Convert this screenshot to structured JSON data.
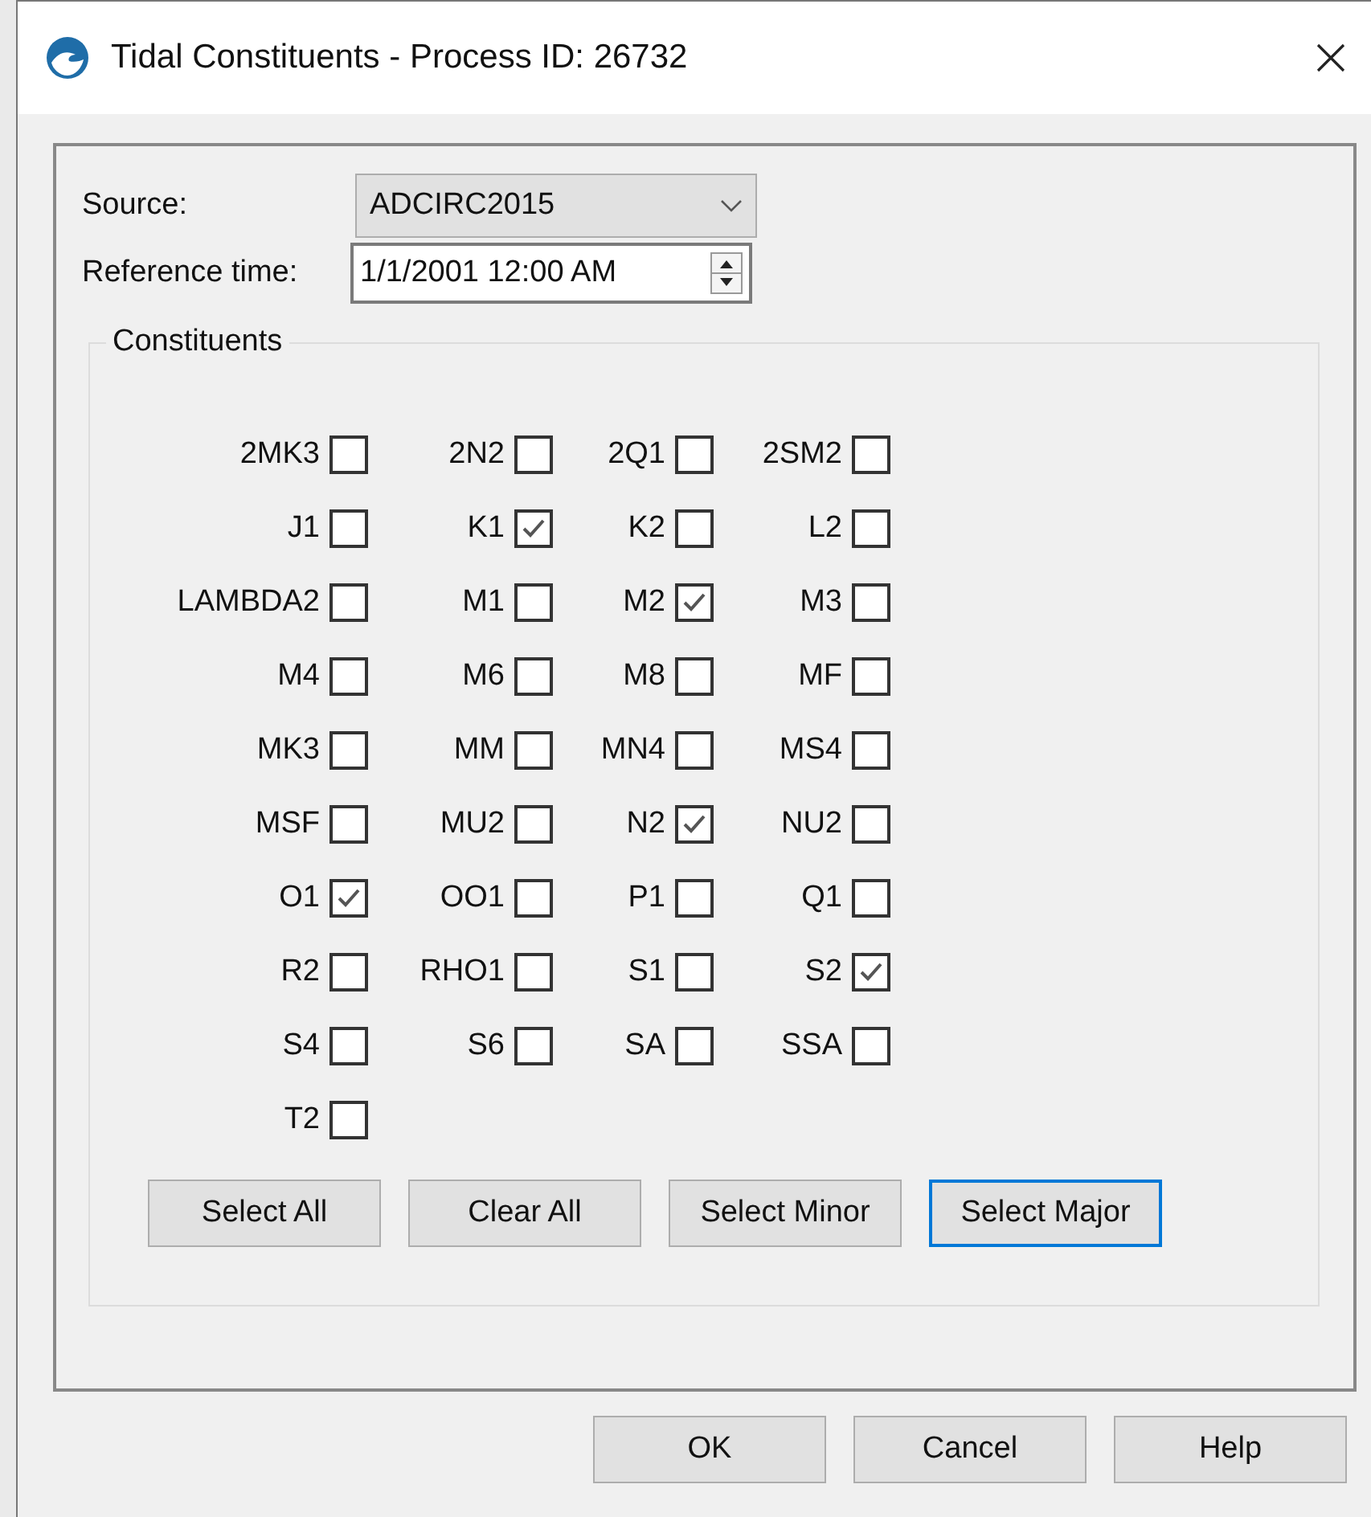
{
  "window": {
    "title": "Tidal Constituents - Process ID: 26732"
  },
  "source": {
    "label": "Source:",
    "value": "ADCIRC2015"
  },
  "reference_time": {
    "label": "Reference time:",
    "value": "1/1/2001 12:00 AM"
  },
  "constituents": {
    "title": "Constituents",
    "items": [
      {
        "label": "2MK3",
        "checked": false
      },
      {
        "label": "2N2",
        "checked": false
      },
      {
        "label": "2Q1",
        "checked": false
      },
      {
        "label": "2SM2",
        "checked": false
      },
      {
        "label": "J1",
        "checked": false
      },
      {
        "label": "K1",
        "checked": true
      },
      {
        "label": "K2",
        "checked": false
      },
      {
        "label": "L2",
        "checked": false
      },
      {
        "label": "LAMBDA2",
        "checked": false
      },
      {
        "label": "M1",
        "checked": false
      },
      {
        "label": "M2",
        "checked": true
      },
      {
        "label": "M3",
        "checked": false
      },
      {
        "label": "M4",
        "checked": false
      },
      {
        "label": "M6",
        "checked": false
      },
      {
        "label": "M8",
        "checked": false
      },
      {
        "label": "MF",
        "checked": false
      },
      {
        "label": "MK3",
        "checked": false
      },
      {
        "label": "MM",
        "checked": false
      },
      {
        "label": "MN4",
        "checked": false
      },
      {
        "label": "MS4",
        "checked": false
      },
      {
        "label": "MSF",
        "checked": false
      },
      {
        "label": "MU2",
        "checked": false
      },
      {
        "label": "N2",
        "checked": true
      },
      {
        "label": "NU2",
        "checked": false
      },
      {
        "label": "O1",
        "checked": true
      },
      {
        "label": "OO1",
        "checked": false
      },
      {
        "label": "P1",
        "checked": false
      },
      {
        "label": "Q1",
        "checked": false
      },
      {
        "label": "R2",
        "checked": false
      },
      {
        "label": "RHO1",
        "checked": false
      },
      {
        "label": "S1",
        "checked": false
      },
      {
        "label": "S2",
        "checked": true
      },
      {
        "label": "S4",
        "checked": false
      },
      {
        "label": "S6",
        "checked": false
      },
      {
        "label": "SA",
        "checked": false
      },
      {
        "label": "SSA",
        "checked": false
      },
      {
        "label": "T2",
        "checked": false
      }
    ],
    "buttons": [
      {
        "label": "Select All",
        "focused": false
      },
      {
        "label": "Clear All",
        "focused": false
      },
      {
        "label": "Select Minor",
        "focused": false
      },
      {
        "label": "Select Major",
        "focused": true
      }
    ]
  },
  "buttons": [
    "OK",
    "Cancel",
    "Help"
  ]
}
